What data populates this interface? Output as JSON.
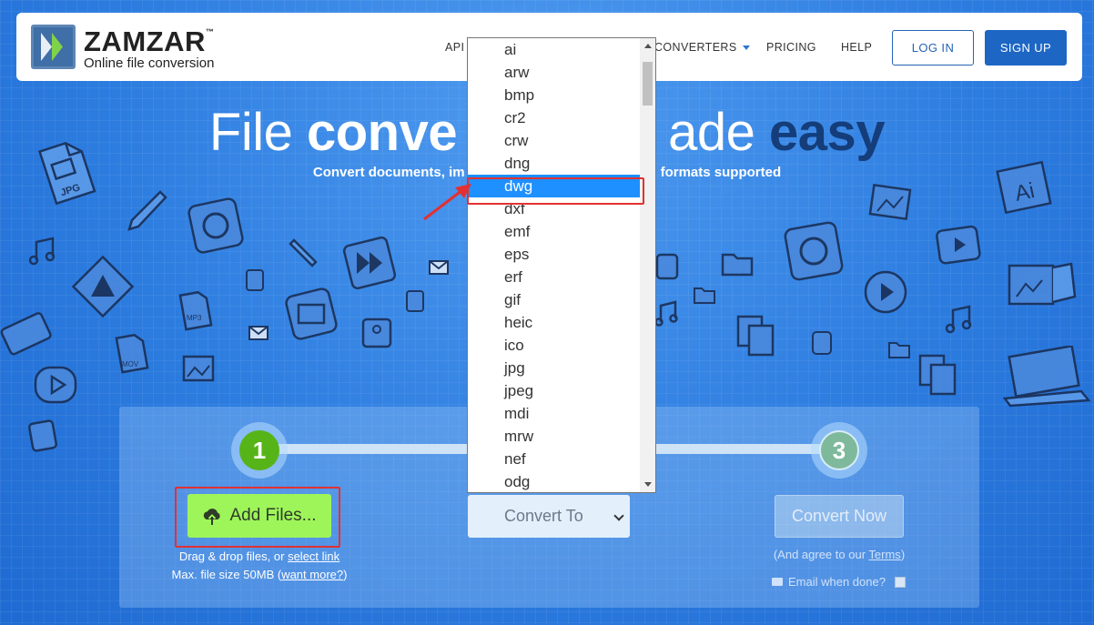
{
  "header": {
    "brand": "ZAMZAR",
    "trademark": "™",
    "tagline": "Online file conversion",
    "nav": {
      "api": "API",
      "converters": "CONVERTERS",
      "pricing": "PRICING",
      "help": "HELP"
    },
    "login": "LOG IN",
    "signup": "SIGN UP"
  },
  "hero": {
    "title_part1": "File",
    "title_part2": "conve",
    "title_part3": "ade",
    "title_part4": "easy",
    "subtitle_left": "Convert documents, im",
    "subtitle_right": "formats supported"
  },
  "steps": {
    "step1": "1",
    "step3": "3"
  },
  "add_files": {
    "label": "Add Files...",
    "drag_text": "Drag & drop files, or",
    "select_link": "select link",
    "max_size": "Max. file size 50MB",
    "want_more": "want more?"
  },
  "convert_to": {
    "selected": "Convert To"
  },
  "convert_now": {
    "label": "Convert Now",
    "terms_prefix": "(And agree to our",
    "terms_link": "Terms",
    "terms_suffix": ")",
    "email_label": "Email when done?"
  },
  "dropdown": {
    "options": [
      "ai",
      "arw",
      "bmp",
      "cr2",
      "crw",
      "dng",
      "dwg",
      "dxf",
      "emf",
      "eps",
      "erf",
      "gif",
      "heic",
      "ico",
      "jpg",
      "jpeg",
      "mdi",
      "mrw",
      "nef",
      "odg"
    ],
    "selected_index": 6
  },
  "colors": {
    "accent": "#1d66c4",
    "selection": "#1e90ff",
    "add_button": "#9ef55a",
    "step_active": "#57b418",
    "annotation": "#e33131"
  },
  "doodle_labels": {
    "jpg": "JPG",
    "mp3": "MP3",
    "mov": "MOV",
    "ai": "Ai"
  }
}
